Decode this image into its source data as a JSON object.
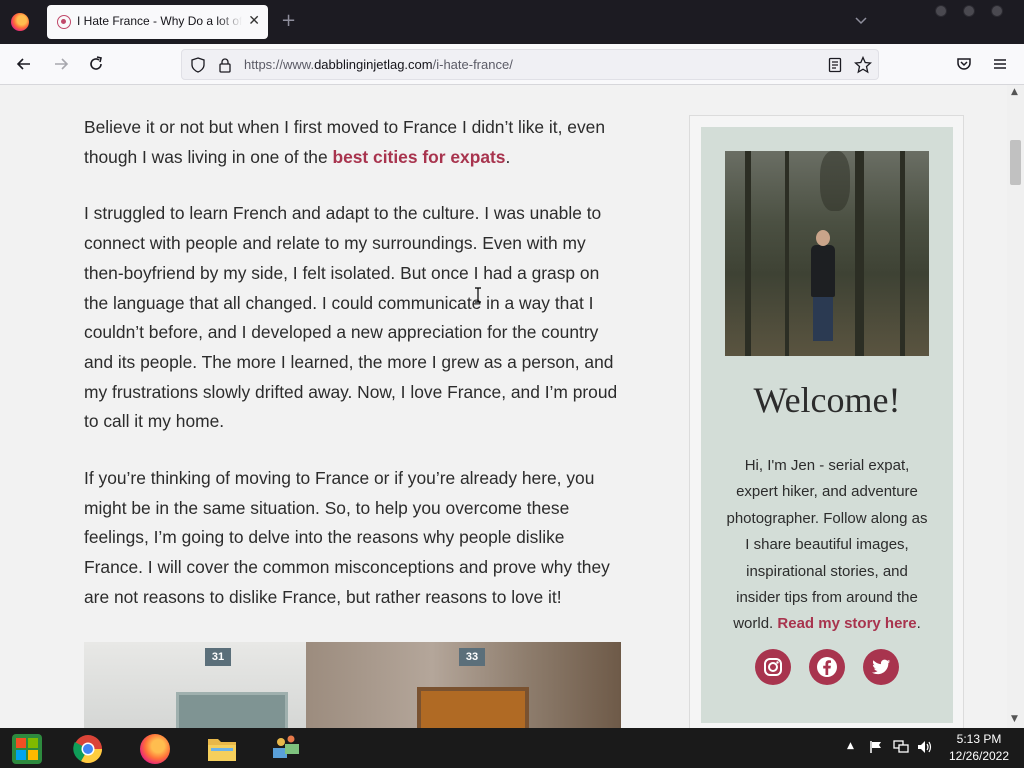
{
  "browser": {
    "tab": {
      "title": "I Hate France - Why Do a lot of"
    },
    "url": {
      "prefix": "https://www.",
      "domain": "dabblinginjetlag.com",
      "path": "/i-hate-france/"
    }
  },
  "article": {
    "p1_before": "Believe it or not but when I first moved to France I didn’t like it, even though I was living in one of the ",
    "p1_link": "best cities for expats",
    "p1_after": ".",
    "p2": "I struggled to learn French and adapt to the culture. I was unable to connect with people and relate to my surroundings. Even with my then-boyfriend by my side, I felt isolated. But once I had a grasp on the language that all changed. I could communicate in a way that I couldn’t before, and I developed a new appreciation for the country and its people. The more I learned, the more I grew as a person, and my frustrations slowly drifted away. Now, I love France, and I’m proud to call it my home.",
    "p3": "If you’re thinking of moving to France or if you’re already here, you might be in the same situation. So, to help you overcome these feelings, I’m going to delve into the reasons why people dislike France. I will cover the common misconceptions and prove why they are not reasons to dislike France, but rather reasons to love it!",
    "photo_numbers": [
      "31",
      "33"
    ]
  },
  "sidebar": {
    "heading": "Welcome!",
    "bio": "Hi, I'm Jen - serial expat, expert hiker, and adventure photographer. Follow along as I share beautiful images, inspirational stories, and insider tips from around the world. ",
    "bio_link": "Read my story here",
    "bio_end": ".",
    "social": [
      "instagram-icon",
      "facebook-icon",
      "twitter-icon"
    ]
  },
  "taskbar": {
    "time": "5:13 PM",
    "date": "12/26/2022"
  },
  "colors": {
    "accent": "#a8344e",
    "sidebar_bg": "#d3ddd7"
  }
}
